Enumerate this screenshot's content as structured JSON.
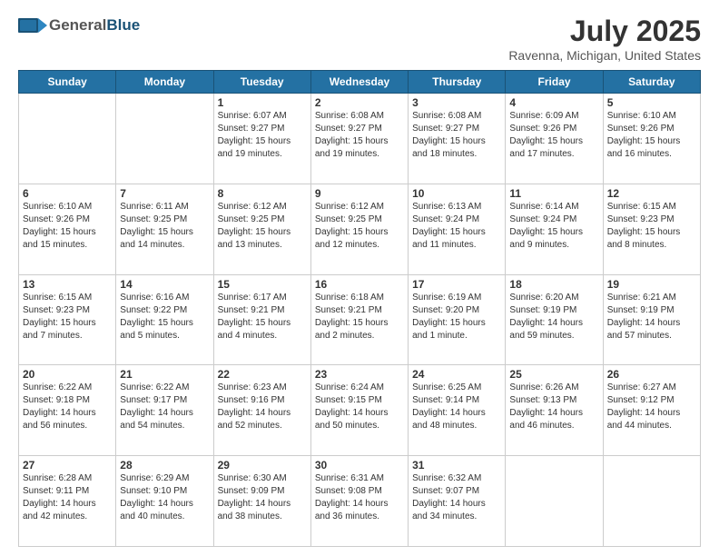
{
  "header": {
    "logo_general": "General",
    "logo_blue": "Blue",
    "month_title": "July 2025",
    "location": "Ravenna, Michigan, United States"
  },
  "weekdays": [
    "Sunday",
    "Monday",
    "Tuesday",
    "Wednesday",
    "Thursday",
    "Friday",
    "Saturday"
  ],
  "weeks": [
    [
      {
        "day": "",
        "info": ""
      },
      {
        "day": "",
        "info": ""
      },
      {
        "day": "1",
        "info": "Sunrise: 6:07 AM\nSunset: 9:27 PM\nDaylight: 15 hours\nand 19 minutes."
      },
      {
        "day": "2",
        "info": "Sunrise: 6:08 AM\nSunset: 9:27 PM\nDaylight: 15 hours\nand 19 minutes."
      },
      {
        "day": "3",
        "info": "Sunrise: 6:08 AM\nSunset: 9:27 PM\nDaylight: 15 hours\nand 18 minutes."
      },
      {
        "day": "4",
        "info": "Sunrise: 6:09 AM\nSunset: 9:26 PM\nDaylight: 15 hours\nand 17 minutes."
      },
      {
        "day": "5",
        "info": "Sunrise: 6:10 AM\nSunset: 9:26 PM\nDaylight: 15 hours\nand 16 minutes."
      }
    ],
    [
      {
        "day": "6",
        "info": "Sunrise: 6:10 AM\nSunset: 9:26 PM\nDaylight: 15 hours\nand 15 minutes."
      },
      {
        "day": "7",
        "info": "Sunrise: 6:11 AM\nSunset: 9:25 PM\nDaylight: 15 hours\nand 14 minutes."
      },
      {
        "day": "8",
        "info": "Sunrise: 6:12 AM\nSunset: 9:25 PM\nDaylight: 15 hours\nand 13 minutes."
      },
      {
        "day": "9",
        "info": "Sunrise: 6:12 AM\nSunset: 9:25 PM\nDaylight: 15 hours\nand 12 minutes."
      },
      {
        "day": "10",
        "info": "Sunrise: 6:13 AM\nSunset: 9:24 PM\nDaylight: 15 hours\nand 11 minutes."
      },
      {
        "day": "11",
        "info": "Sunrise: 6:14 AM\nSunset: 9:24 PM\nDaylight: 15 hours\nand 9 minutes."
      },
      {
        "day": "12",
        "info": "Sunrise: 6:15 AM\nSunset: 9:23 PM\nDaylight: 15 hours\nand 8 minutes."
      }
    ],
    [
      {
        "day": "13",
        "info": "Sunrise: 6:15 AM\nSunset: 9:23 PM\nDaylight: 15 hours\nand 7 minutes."
      },
      {
        "day": "14",
        "info": "Sunrise: 6:16 AM\nSunset: 9:22 PM\nDaylight: 15 hours\nand 5 minutes."
      },
      {
        "day": "15",
        "info": "Sunrise: 6:17 AM\nSunset: 9:21 PM\nDaylight: 15 hours\nand 4 minutes."
      },
      {
        "day": "16",
        "info": "Sunrise: 6:18 AM\nSunset: 9:21 PM\nDaylight: 15 hours\nand 2 minutes."
      },
      {
        "day": "17",
        "info": "Sunrise: 6:19 AM\nSunset: 9:20 PM\nDaylight: 15 hours\nand 1 minute."
      },
      {
        "day": "18",
        "info": "Sunrise: 6:20 AM\nSunset: 9:19 PM\nDaylight: 14 hours\nand 59 minutes."
      },
      {
        "day": "19",
        "info": "Sunrise: 6:21 AM\nSunset: 9:19 PM\nDaylight: 14 hours\nand 57 minutes."
      }
    ],
    [
      {
        "day": "20",
        "info": "Sunrise: 6:22 AM\nSunset: 9:18 PM\nDaylight: 14 hours\nand 56 minutes."
      },
      {
        "day": "21",
        "info": "Sunrise: 6:22 AM\nSunset: 9:17 PM\nDaylight: 14 hours\nand 54 minutes."
      },
      {
        "day": "22",
        "info": "Sunrise: 6:23 AM\nSunset: 9:16 PM\nDaylight: 14 hours\nand 52 minutes."
      },
      {
        "day": "23",
        "info": "Sunrise: 6:24 AM\nSunset: 9:15 PM\nDaylight: 14 hours\nand 50 minutes."
      },
      {
        "day": "24",
        "info": "Sunrise: 6:25 AM\nSunset: 9:14 PM\nDaylight: 14 hours\nand 48 minutes."
      },
      {
        "day": "25",
        "info": "Sunrise: 6:26 AM\nSunset: 9:13 PM\nDaylight: 14 hours\nand 46 minutes."
      },
      {
        "day": "26",
        "info": "Sunrise: 6:27 AM\nSunset: 9:12 PM\nDaylight: 14 hours\nand 44 minutes."
      }
    ],
    [
      {
        "day": "27",
        "info": "Sunrise: 6:28 AM\nSunset: 9:11 PM\nDaylight: 14 hours\nand 42 minutes."
      },
      {
        "day": "28",
        "info": "Sunrise: 6:29 AM\nSunset: 9:10 PM\nDaylight: 14 hours\nand 40 minutes."
      },
      {
        "day": "29",
        "info": "Sunrise: 6:30 AM\nSunset: 9:09 PM\nDaylight: 14 hours\nand 38 minutes."
      },
      {
        "day": "30",
        "info": "Sunrise: 6:31 AM\nSunset: 9:08 PM\nDaylight: 14 hours\nand 36 minutes."
      },
      {
        "day": "31",
        "info": "Sunrise: 6:32 AM\nSunset: 9:07 PM\nDaylight: 14 hours\nand 34 minutes."
      },
      {
        "day": "",
        "info": ""
      },
      {
        "day": "",
        "info": ""
      }
    ]
  ]
}
